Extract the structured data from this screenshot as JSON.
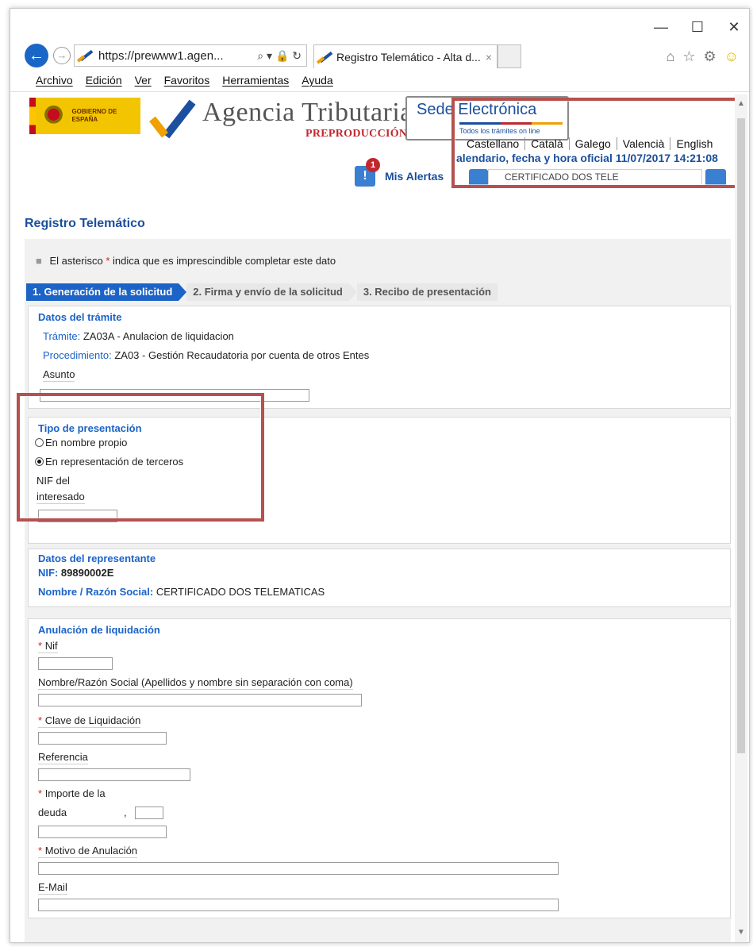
{
  "window_controls": {
    "minimize": "—",
    "maximize": "☐",
    "close": "✕"
  },
  "browser": {
    "address": "https://prewww1.agen...",
    "address_icons": "⌕ ▾ 🔒 ↻",
    "tab_title": "Registro Telemático - Alta d...",
    "tab_close": "×"
  },
  "menu": [
    "Archivo",
    "Edición",
    "Ver",
    "Favoritos",
    "Herramientas",
    "Ayuda"
  ],
  "header": {
    "gobierno": "GOBIERNO DE ESPAÑA",
    "agencia": "Agencia Tributaria",
    "prepro": "PREPRODUCCIÓN",
    "sede_title": "Sede Electrónica",
    "sede_sub": "Todos los trámites on line",
    "languages": [
      "Castellano",
      "Català",
      "Galego",
      "Valencià",
      "English"
    ],
    "calendar": "alendario, fecha y hora oficial 11/07/2017 14:21:08",
    "alerts_count": "1",
    "alerts_label": "Mis Alertas",
    "cert_text": "CERTIFICADO DOS TELE"
  },
  "page": {
    "title": "Registro Telemático",
    "note_before": "El asterisco",
    "note_star": "*",
    "note_after": "indica que es imprescindible completar este dato",
    "steps": [
      "1. Generación de la solicitud",
      "2. Firma y envío de la solicitud",
      "3. Recibo de presentación"
    ]
  },
  "tramite": {
    "title": "Datos del trámite",
    "tramite_label": "Trámite:",
    "tramite_value": "ZA03A - Anulacion de liquidacion",
    "proc_label": "Procedimiento:",
    "proc_value": "ZA03 - Gestión Recaudatoria por cuenta de otros Entes",
    "asunto": "Asunto"
  },
  "presentacion": {
    "title": "Tipo de presentación",
    "option1": "En nombre propio",
    "option2": "En representación de terceros",
    "selected": "En representación de terceros",
    "nif_line1": "NIF del",
    "nif_line2": "interesado"
  },
  "representante": {
    "title": "Datos del representante",
    "nif_label": "NIF:",
    "nif_value": "89890002E",
    "nombre_label": "Nombre / Razón Social:",
    "nombre_value": "CERTIFICADO DOS TELEMATICAS"
  },
  "anulacion": {
    "title": "Anulación de liquidación",
    "star": "*",
    "nif": "Nif",
    "nombre": "Nombre/Razón Social (Apellidos y nombre sin separación con coma)",
    "clave": "Clave de Liquidación",
    "referencia": "Referencia",
    "importe1": "Importe de la",
    "importe2": "deuda",
    "decimal_sep": ",",
    "motivo": "Motivo de Anulación",
    "email": "E-Mail"
  },
  "colors": {
    "brand_blue": "#1b63c7",
    "highlight_red": "#b5514f",
    "required": "#d0202a"
  }
}
